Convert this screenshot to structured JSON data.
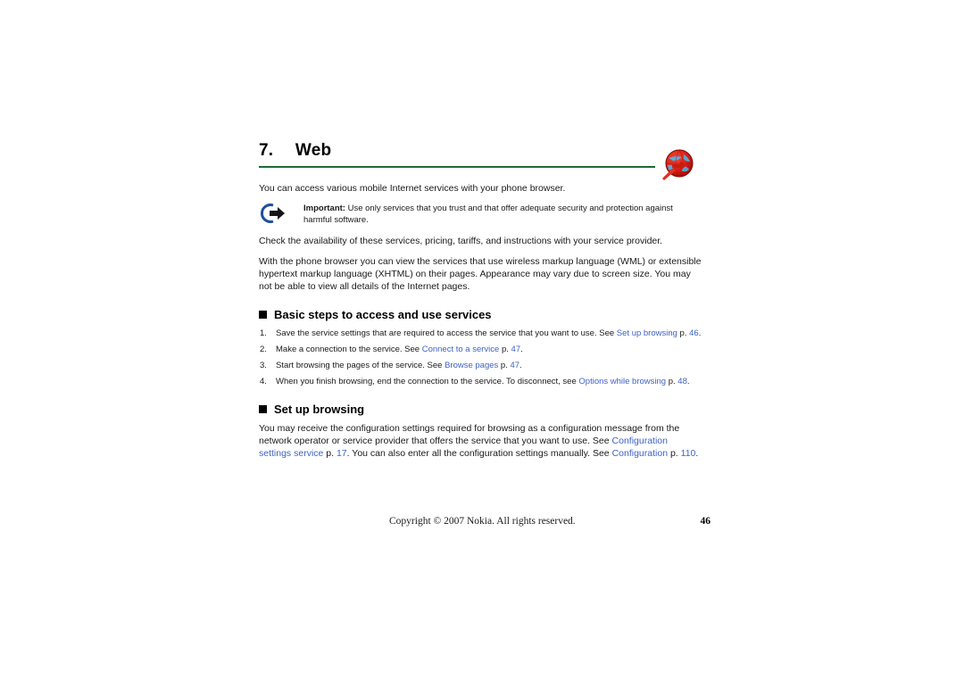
{
  "page": {
    "chapter_number": "7.",
    "chapter_title": "7.  Web",
    "rule_color": "#1a6b33",
    "link_color": "#3f63c6",
    "background": "#ffffff"
  },
  "icons": {
    "chapter": "web-globe-icon",
    "note": "important-arrow-icon",
    "bullet": "black-square-bullet-icon"
  },
  "intro": {
    "paragraph_1": "You can access various mobile Internet services with your phone browser."
  },
  "note": {
    "label": "Important:",
    "text": " Use only services that you trust and that offer adequate security and protection against harmful software."
  },
  "body": {
    "paragraph_2": "Check the availability of these services, pricing, tariffs, and instructions with your service provider.",
    "paragraph_3": "With the phone browser you can view the services that use wireless markup language (WML) or extensible hypertext markup language (XHTML) on their pages. Appearance may vary due to screen size. You may not be able to view all details of the Internet pages."
  },
  "sections": [
    {
      "heading": "Basic steps to access and use services",
      "steps": [
        {
          "num": "1.",
          "pre": "Save the service settings that are required to access the service that you want to use. See ",
          "link": "Set up browsing",
          "mid": " p. ",
          "page_link": "46",
          "post": "."
        },
        {
          "num": "2.",
          "pre": "Make a connection to the service. See ",
          "link": "Connect to a service",
          "mid": " p. ",
          "page_link": "47",
          "post": "."
        },
        {
          "num": "3.",
          "pre": "Start browsing the pages of the service. See ",
          "link": "Browse pages",
          "mid": " p. ",
          "page_link": "47",
          "post": "."
        },
        {
          "num": "4.",
          "pre": "When you finish browsing, end the connection to the service. To disconnect, see ",
          "link": "Options while browsing",
          "mid": " p. ",
          "page_link": "48",
          "post": "."
        }
      ]
    },
    {
      "heading": "Set up browsing",
      "paragraph": {
        "seg_1": "You may receive the configuration settings required for browsing as a configuration message from the network operator or service provider that offers the service that you want to use. See ",
        "link_1": "Configuration settings service",
        "seg_2": " p. ",
        "link_2": "17",
        "seg_3": ". You can also enter all the configuration settings manually. See ",
        "link_3": "Configuration",
        "seg_4": " p. ",
        "link_4": "110",
        "seg_5": "."
      }
    }
  ],
  "footer": {
    "copyright": "Copyright © 2007 Nokia. All rights reserved.",
    "page_number": "46"
  }
}
